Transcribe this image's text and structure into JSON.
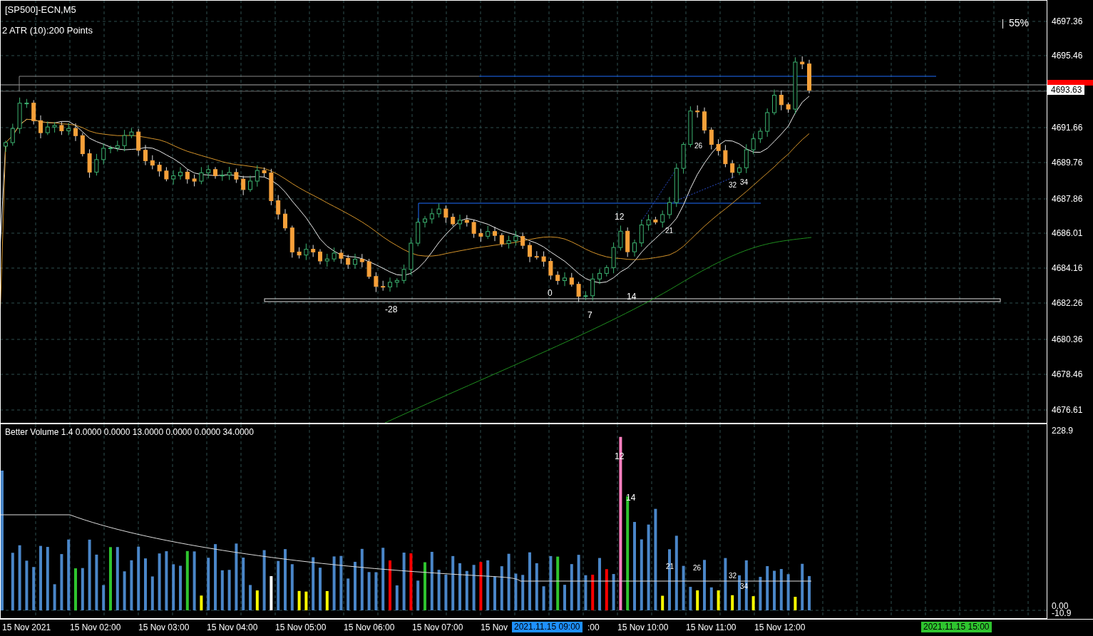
{
  "window": {
    "title": "[SP500]-ECN,M5"
  },
  "main_chart": {
    "indicator_label": "2 ATR (10):200 Points",
    "zoom_reading": "55%",
    "price_axis": [
      "4697.36",
      "4695.46",
      "4691.66",
      "4689.76",
      "4687.86",
      "4686.01",
      "4684.16",
      "4682.26",
      "4680.36",
      "4678.46",
      "4676.61"
    ],
    "current_price": "4693.63",
    "annotations": [
      "12",
      "21",
      "26",
      "32",
      "34",
      "0",
      "-28",
      "7",
      "14"
    ]
  },
  "volume_panel": {
    "label": "Better Volume 1.4 0.0000 0.0000 13.0000 0.0000 0.0000 34.0000",
    "axis": [
      "228.9",
      "0.00",
      "-10.9"
    ],
    "annotations": [
      "12",
      "14",
      "21",
      "26",
      "32",
      "34"
    ]
  },
  "time_axis": {
    "labels": [
      "15 Nov 2021",
      "15 Nov 02:00",
      "15 Nov 03:00",
      "15 Nov 04:00",
      "15 Nov 05:00",
      "15 Nov 06:00",
      "15 Nov 07:00",
      "15 Nov",
      ":00",
      "15 Nov 10:00",
      "15 Nov 11:00",
      "15 Nov 12:00"
    ],
    "crosshair_label": "2021.11.15 09:00",
    "end_label": "2021.11.15 15:00"
  }
}
